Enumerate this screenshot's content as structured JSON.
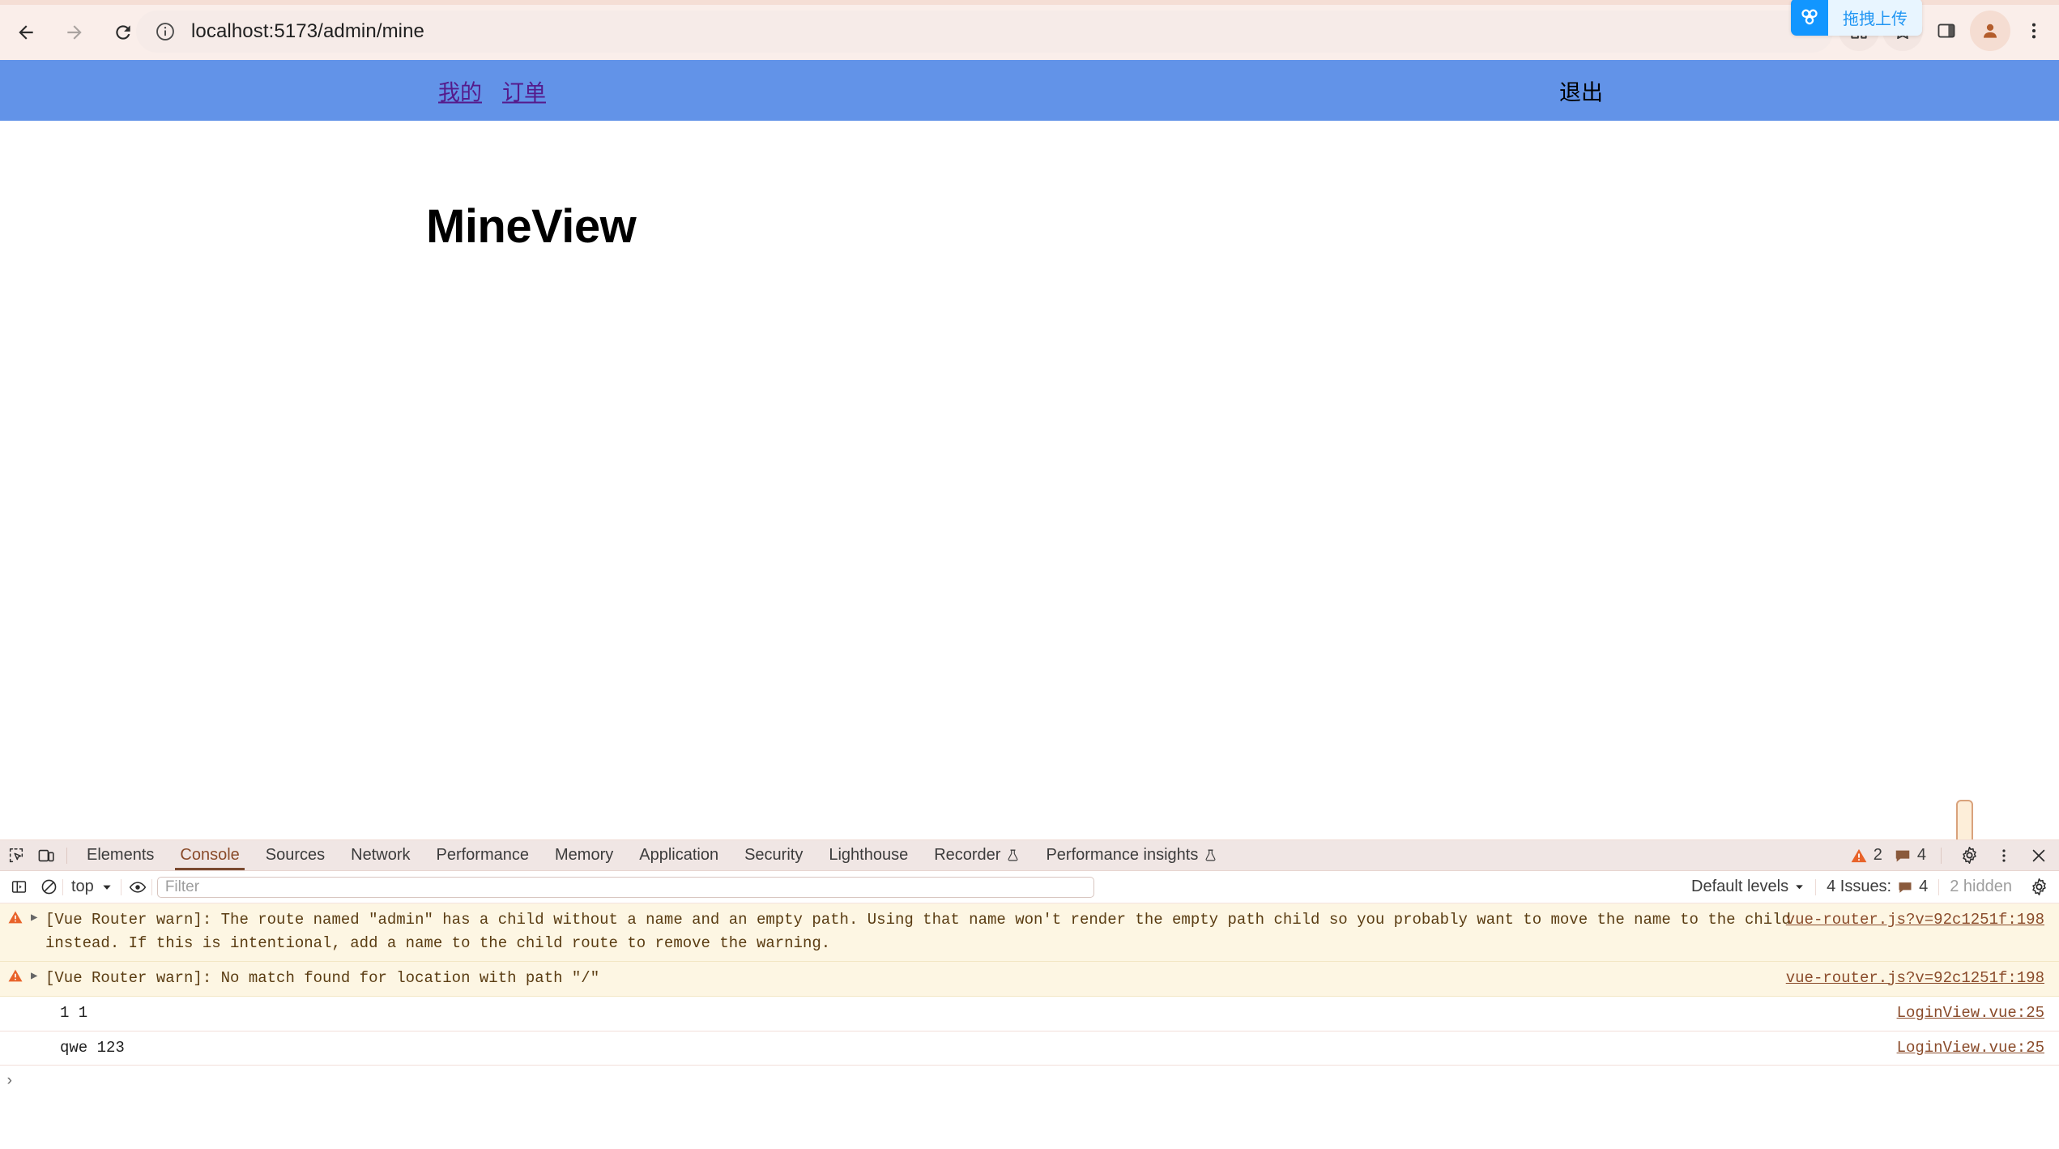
{
  "browser": {
    "url": "localhost:5173/admin/mine",
    "back_label": "Back",
    "forward_label": "Forward",
    "reload_label": "Reload",
    "site_info_label": "View site information",
    "profile_label": "Profile",
    "menu_label": "Customize and control Chrome",
    "netdisk_popup_label": "拖拽上传"
  },
  "page": {
    "nav_links": [
      {
        "label": "我的"
      },
      {
        "label": "订单"
      }
    ],
    "logout_label": "退出",
    "title": "MineView",
    "nav_bg": "#6293e8",
    "link_color": "#551a8b"
  },
  "devtools": {
    "tabs": [
      {
        "label": "Elements",
        "active": false,
        "flask": false
      },
      {
        "label": "Console",
        "active": true,
        "flask": false
      },
      {
        "label": "Sources",
        "active": false,
        "flask": false
      },
      {
        "label": "Network",
        "active": false,
        "flask": false
      },
      {
        "label": "Performance",
        "active": false,
        "flask": false
      },
      {
        "label": "Memory",
        "active": false,
        "flask": false
      },
      {
        "label": "Application",
        "active": false,
        "flask": false
      },
      {
        "label": "Security",
        "active": false,
        "flask": false
      },
      {
        "label": "Lighthouse",
        "active": false,
        "flask": false
      },
      {
        "label": "Recorder",
        "active": false,
        "flask": true
      },
      {
        "label": "Performance insights",
        "active": false,
        "flask": true
      }
    ],
    "warning_count": "2",
    "message_count": "4",
    "settings_label": "Settings",
    "more_label": "More options",
    "close_label": "Close DevTools",
    "inspect_label": "Inspect element",
    "device_toolbar_label": "Toggle device toolbar",
    "sidebar_label": "Show console sidebar",
    "clear_label": "Clear console",
    "context_selector": "top",
    "live_expression_label": "Create live expression",
    "filter_placeholder": "Filter",
    "filter_value": "",
    "levels_label": "Default levels",
    "issues_label": "4 Issues:",
    "issues_count": "4",
    "hidden_label": "2 hidden",
    "console_settings_label": "Console settings"
  },
  "console": {
    "entries": [
      {
        "type": "warn",
        "expandable": true,
        "text": "[Vue Router warn]: The route named \"admin\" has a child without a name and an empty path. Using that name won't render the empty path child so you probably want to move the name to the child instead. If this is intentional, add a name to the child route to remove the warning.",
        "source": "vue-router.js?v=92c1251f:198"
      },
      {
        "type": "warn",
        "expandable": true,
        "text": "[Vue Router warn]: No match found for location with path \"/\"",
        "source": "vue-router.js?v=92c1251f:198"
      },
      {
        "type": "log",
        "expandable": false,
        "text": "1 1",
        "source": "LoginView.vue:25"
      },
      {
        "type": "log",
        "expandable": false,
        "text": "qwe 123",
        "source": "LoginView.vue:25"
      }
    ],
    "prompt_symbol": "›"
  }
}
